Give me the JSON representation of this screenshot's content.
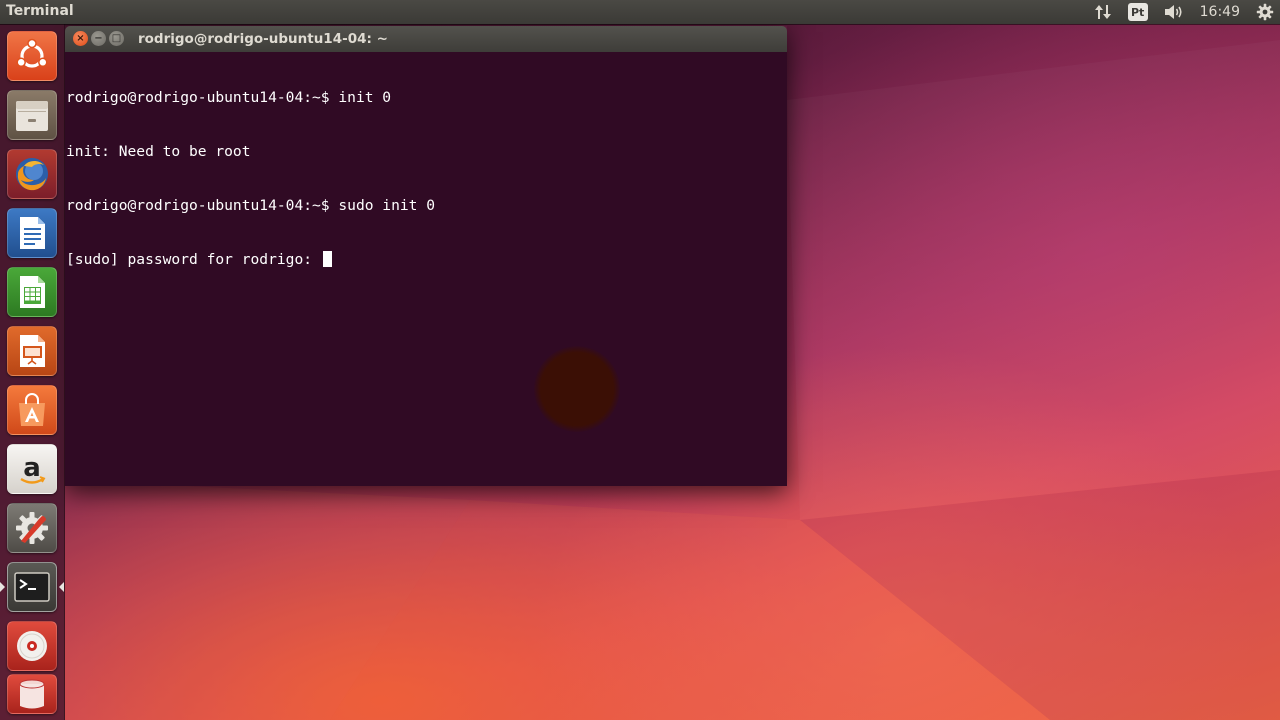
{
  "top_panel": {
    "app_title": "Terminal",
    "keyboard_layout": "Pt",
    "clock": "16:49",
    "icons": [
      "network-updown-icon",
      "keyboard-layout-icon",
      "volume-icon",
      "gear-icon"
    ]
  },
  "launcher": {
    "items": [
      {
        "name": "ubuntu-dash",
        "icon": "ubuntu-logo-icon"
      },
      {
        "name": "files",
        "icon": "file-cabinet-icon"
      },
      {
        "name": "firefox",
        "icon": "firefox-icon"
      },
      {
        "name": "libreoffice-writer",
        "icon": "writer-document-icon"
      },
      {
        "name": "libreoffice-calc",
        "icon": "calc-spreadsheet-icon"
      },
      {
        "name": "libreoffice-impress",
        "icon": "impress-presentation-icon"
      },
      {
        "name": "ubuntu-software-center",
        "icon": "software-center-bag-icon"
      },
      {
        "name": "amazon",
        "icon": "amazon-logo-icon"
      },
      {
        "name": "system-settings",
        "icon": "settings-wrench-gear-icon"
      },
      {
        "name": "terminal",
        "icon": "terminal-prompt-icon",
        "running": true
      },
      {
        "name": "optical-disc",
        "icon": "dvd-disc-icon"
      },
      {
        "name": "trash",
        "icon": "trash-can-icon"
      }
    ]
  },
  "terminal_window": {
    "title": "rodrigo@rodrigo-ubuntu14-04: ~",
    "buttons": {
      "close": "×",
      "minimize": "−",
      "maximize": "□"
    },
    "lines": [
      "rodrigo@rodrigo-ubuntu14-04:~$ init 0",
      "init: Need to be root",
      "rodrigo@rodrigo-ubuntu14-04:~$ sudo init 0",
      "[sudo] password for rodrigo: "
    ],
    "background": "#300a24"
  },
  "colors": {
    "panel": "#3c3b37",
    "ubuntu_orange": "#dd4814",
    "terminal_bg": "#300a24"
  }
}
